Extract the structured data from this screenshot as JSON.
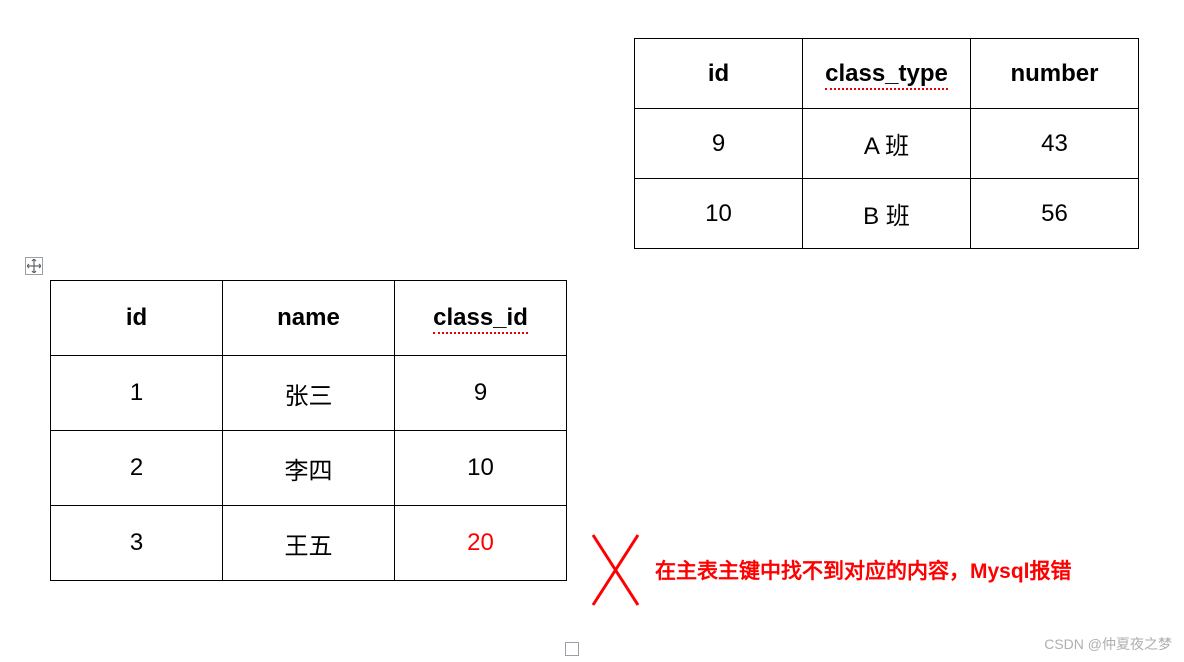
{
  "table_class": {
    "headers": [
      "id",
      "class_type",
      "number"
    ],
    "rows": [
      {
        "id": "9",
        "class_type": "A 班",
        "number": "43"
      },
      {
        "id": "10",
        "class_type": "B 班",
        "number": "56"
      }
    ]
  },
  "table_student": {
    "headers": [
      "id",
      "name",
      "class_id"
    ],
    "rows": [
      {
        "id": "1",
        "name": "张三",
        "class_id": "9",
        "class_id_error": false
      },
      {
        "id": "2",
        "name": "李四",
        "class_id": "10",
        "class_id_error": false
      },
      {
        "id": "3",
        "name": "王五",
        "class_id": "20",
        "class_id_error": true
      }
    ]
  },
  "annotation": "在主表主键中找不到对应的内容，Mysql报错",
  "watermark": "CSDN @仲夏夜之梦"
}
